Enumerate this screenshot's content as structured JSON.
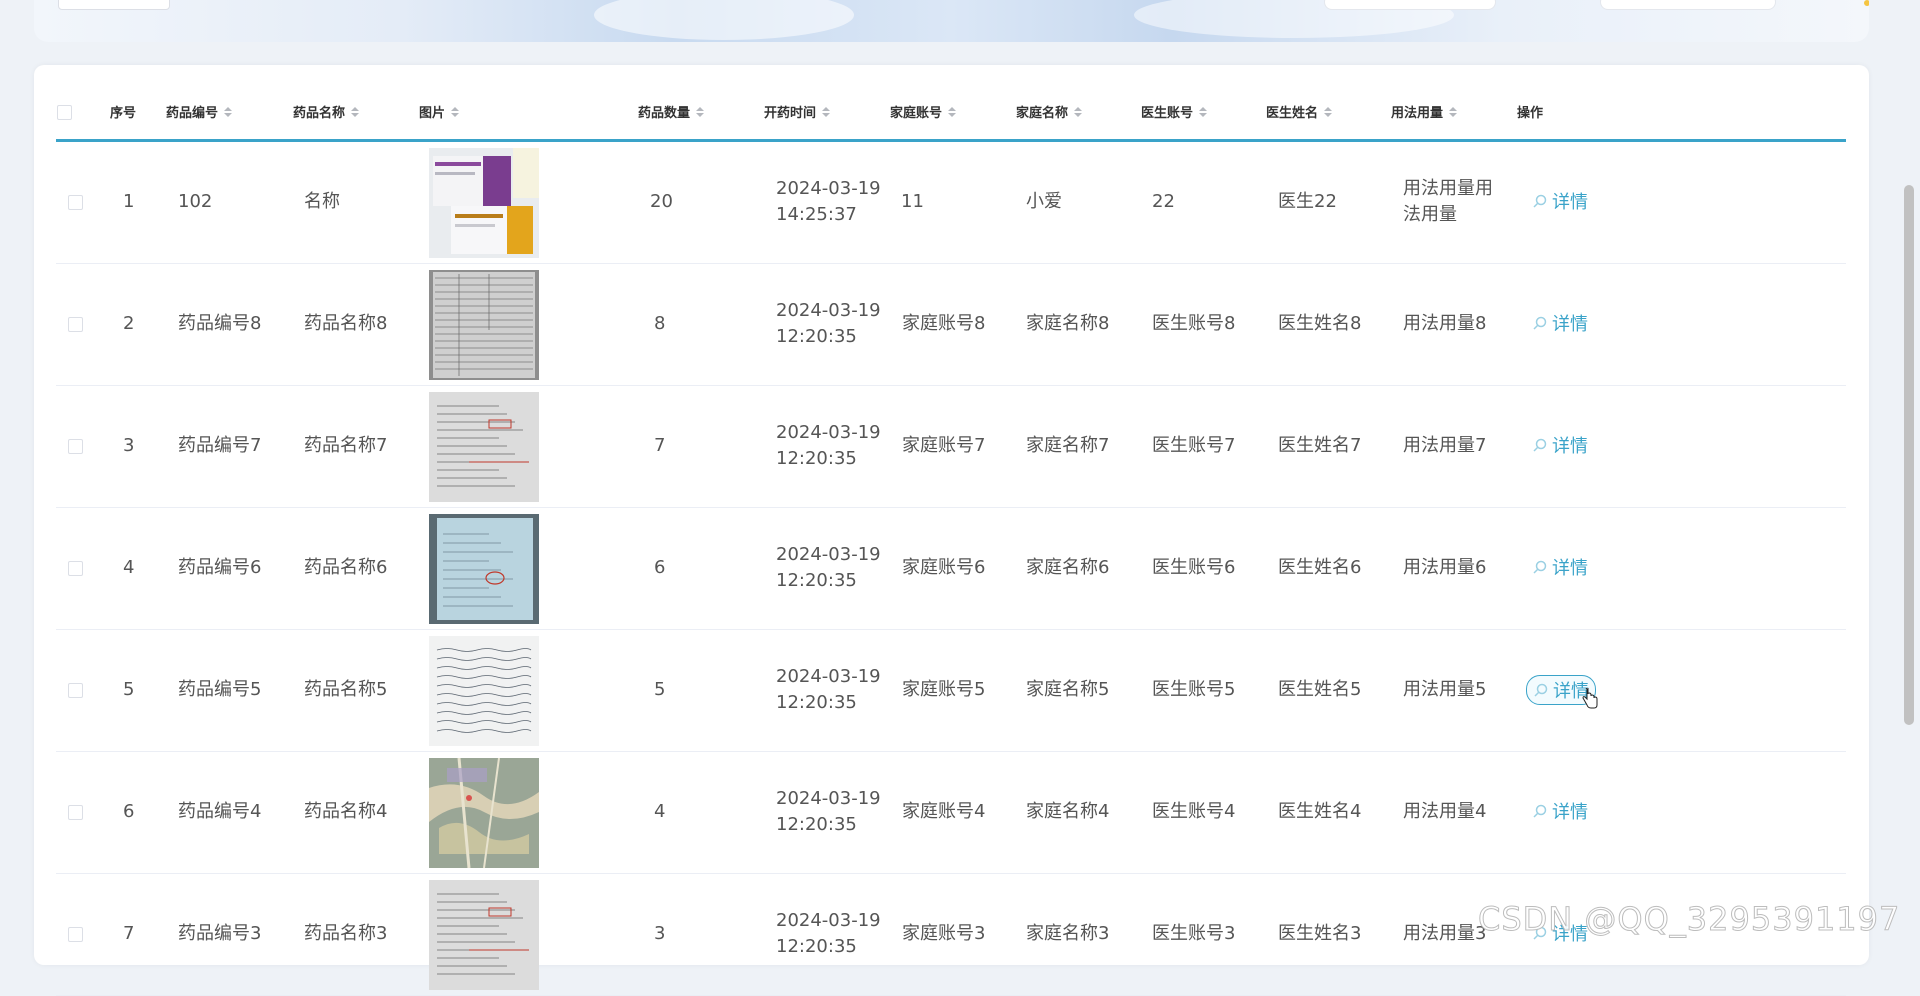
{
  "table": {
    "headers": {
      "index": "序号",
      "code": "药品编号",
      "name": "药品名称",
      "image": "图片",
      "quantity": "药品数量",
      "time": "开药时间",
      "family_account": "家庭账号",
      "family_name": "家庭名称",
      "doctor_account": "医生账号",
      "doctor_name": "医生姓名",
      "usage": "用法用量",
      "actions": "操作"
    },
    "detail_label": "详情",
    "rows": [
      {
        "index": "1",
        "code": "102",
        "name": "名称",
        "image": "medicine-box-photo",
        "quantity": "20",
        "date": "2024-03-19",
        "time": "14:25:37",
        "family_account": "11",
        "family_name": "小爱",
        "doctor_account": "22",
        "doctor_name": "医生22",
        "usage": "用法用量用法用量"
      },
      {
        "index": "2",
        "code": "药品编号8",
        "name": "药品名称8",
        "image": "prescription-form-photo",
        "quantity": "8",
        "date": "2024-03-19",
        "time": "12:20:35",
        "family_account": "家庭账号8",
        "family_name": "家庭名称8",
        "doctor_account": "医生账号8",
        "doctor_name": "医生姓名8",
        "usage": "用法用量8"
      },
      {
        "index": "3",
        "code": "药品编号7",
        "name": "药品名称7",
        "image": "prescription-sheet-photo",
        "quantity": "7",
        "date": "2024-03-19",
        "time": "12:20:35",
        "family_account": "家庭账号7",
        "family_name": "家庭名称7",
        "doctor_account": "医生账号7",
        "doctor_name": "医生姓名7",
        "usage": "用法用量7"
      },
      {
        "index": "4",
        "code": "药品编号6",
        "name": "药品名称6",
        "image": "blue-prescription-photo",
        "quantity": "6",
        "date": "2024-03-19",
        "time": "12:20:35",
        "family_account": "家庭账号6",
        "family_name": "家庭名称6",
        "doctor_account": "医生账号6",
        "doctor_name": "医生姓名6",
        "usage": "用法用量6"
      },
      {
        "index": "5",
        "code": "药品编号5",
        "name": "药品名称5",
        "image": "handwritten-prescription-photo",
        "quantity": "5",
        "date": "2024-03-19",
        "time": "12:20:35",
        "family_account": "家庭账号5",
        "family_name": "家庭名称5",
        "doctor_account": "医生账号5",
        "doctor_name": "医生姓名5",
        "usage": "用法用量5"
      },
      {
        "index": "6",
        "code": "药品编号4",
        "name": "药品名称4",
        "image": "map-photo",
        "quantity": "4",
        "date": "2024-03-19",
        "time": "12:20:35",
        "family_account": "家庭账号4",
        "family_name": "家庭名称4",
        "doctor_account": "医生账号4",
        "doctor_name": "医生姓名4",
        "usage": "用法用量4"
      },
      {
        "index": "7",
        "code": "药品编号3",
        "name": "药品名称3",
        "image": "prescription-sheet-photo",
        "quantity": "3",
        "date": "2024-03-19",
        "time": "12:20:35",
        "family_account": "家庭账号3",
        "family_name": "家庭名称3",
        "doctor_account": "医生账号3",
        "doctor_name": "医生姓名3",
        "usage": "用法用量3"
      }
    ],
    "hovered_row": 5
  },
  "watermark": "CSDN @QQ_3295391197",
  "colors": {
    "accent": "#3aa3c9",
    "header_border": "#3aa3c9",
    "row_border": "#ebeef5"
  }
}
